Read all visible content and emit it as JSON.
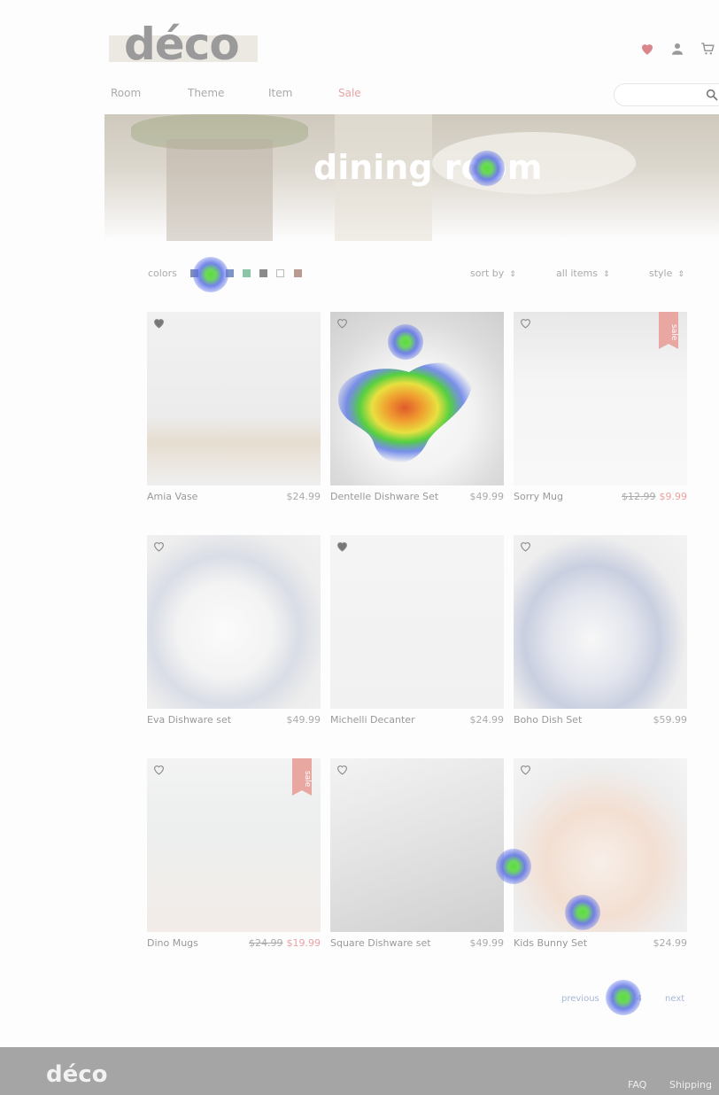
{
  "header": {
    "logo": "déco",
    "nav": [
      {
        "label": "Room"
      },
      {
        "label": "Theme"
      },
      {
        "label": "Item"
      },
      {
        "label": "Sale"
      }
    ],
    "icons": [
      "heart-icon",
      "user-icon",
      "cart-icon"
    ],
    "search_placeholder": ""
  },
  "hero": {
    "title": "dining room"
  },
  "filters": {
    "colors_label": "colors",
    "swatches": [
      "#7f8fb8",
      "#5ea6a0",
      "#7e93c6",
      "#8cc5a6",
      "#8a8a8a",
      "#ffffff",
      "#b89a90"
    ],
    "sort_label": "sort by",
    "items_label": "all items",
    "style_label": "style"
  },
  "products": [
    {
      "name": "Amia Vase",
      "price": "$24.99",
      "old_price": "",
      "sale": false,
      "favorited": true
    },
    {
      "name": "Dentelle Dishware Set",
      "price": "$49.99",
      "old_price": "",
      "sale": false,
      "favorited": false
    },
    {
      "name": "Sorry Mug",
      "price": "$9.99",
      "old_price": "$12.99",
      "sale": true,
      "favorited": false,
      "sale_label": "sale"
    },
    {
      "name": "Eva Dishware set",
      "price": "$49.99",
      "old_price": "",
      "sale": false,
      "favorited": false
    },
    {
      "name": "Michelli Decanter",
      "price": "$24.99",
      "old_price": "",
      "sale": false,
      "favorited": true
    },
    {
      "name": "Boho Dish Set",
      "price": "$59.99",
      "old_price": "",
      "sale": false,
      "favorited": false
    },
    {
      "name": "Dino Mugs",
      "price": "$19.99",
      "old_price": "$24.99",
      "sale": true,
      "favorited": false,
      "sale_label": "sale"
    },
    {
      "name": "Square Dishware set",
      "price": "$49.99",
      "old_price": "",
      "sale": false,
      "favorited": false
    },
    {
      "name": "Kids Bunny Set",
      "price": "$24.99",
      "old_price": "",
      "sale": false,
      "favorited": false
    }
  ],
  "pagination": {
    "previous": "previous",
    "pages": "1 2 3 4",
    "next": "next"
  },
  "footer": {
    "logo": "déco",
    "links": [
      "FAQ",
      "Shipping"
    ]
  },
  "colors": {
    "sale_accent": "#e8a3a3",
    "footer_bg": "#a5a5a5"
  }
}
